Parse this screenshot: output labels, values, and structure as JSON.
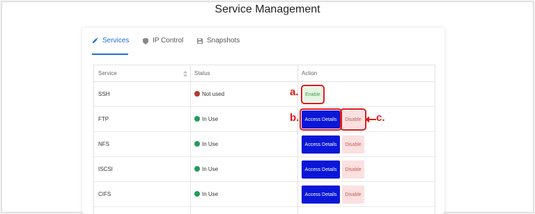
{
  "page": {
    "title": "Service Management"
  },
  "tabs": [
    {
      "label": "Services",
      "icon": "wrench-icon",
      "active": true
    },
    {
      "label": "IP Control",
      "icon": "shield-icon",
      "active": false
    },
    {
      "label": "Snapshots",
      "icon": "save-icon",
      "active": false
    }
  ],
  "table": {
    "headers": {
      "service": "Service",
      "status": "Status",
      "action": "Action"
    },
    "rows": [
      {
        "service": "SSH",
        "status": "Not used",
        "status_color": "#b43a2f",
        "enable_label": "Enable"
      },
      {
        "service": "FTP",
        "status": "In Use",
        "status_color": "#1f9d55",
        "access_label": "Access Details",
        "disable_label": "Disable"
      },
      {
        "service": "NFS",
        "status": "In Use",
        "status_color": "#1f9d55",
        "access_label": "Access Details",
        "disable_label": "Disable"
      },
      {
        "service": "ISCSI",
        "status": "In Use",
        "status_color": "#1f9d55",
        "access_label": "Access Details",
        "disable_label": "Disable"
      },
      {
        "service": "CIFS",
        "status": "In Use",
        "status_color": "#1f9d55",
        "access_label": "Access Details",
        "disable_label": "Disable"
      }
    ]
  },
  "annotations": {
    "a": "a.",
    "b": "b.",
    "c": "c."
  },
  "colors": {
    "accent": "#1e6fd9",
    "annotation": "#e01818",
    "primary_button": "#0a17d8"
  }
}
